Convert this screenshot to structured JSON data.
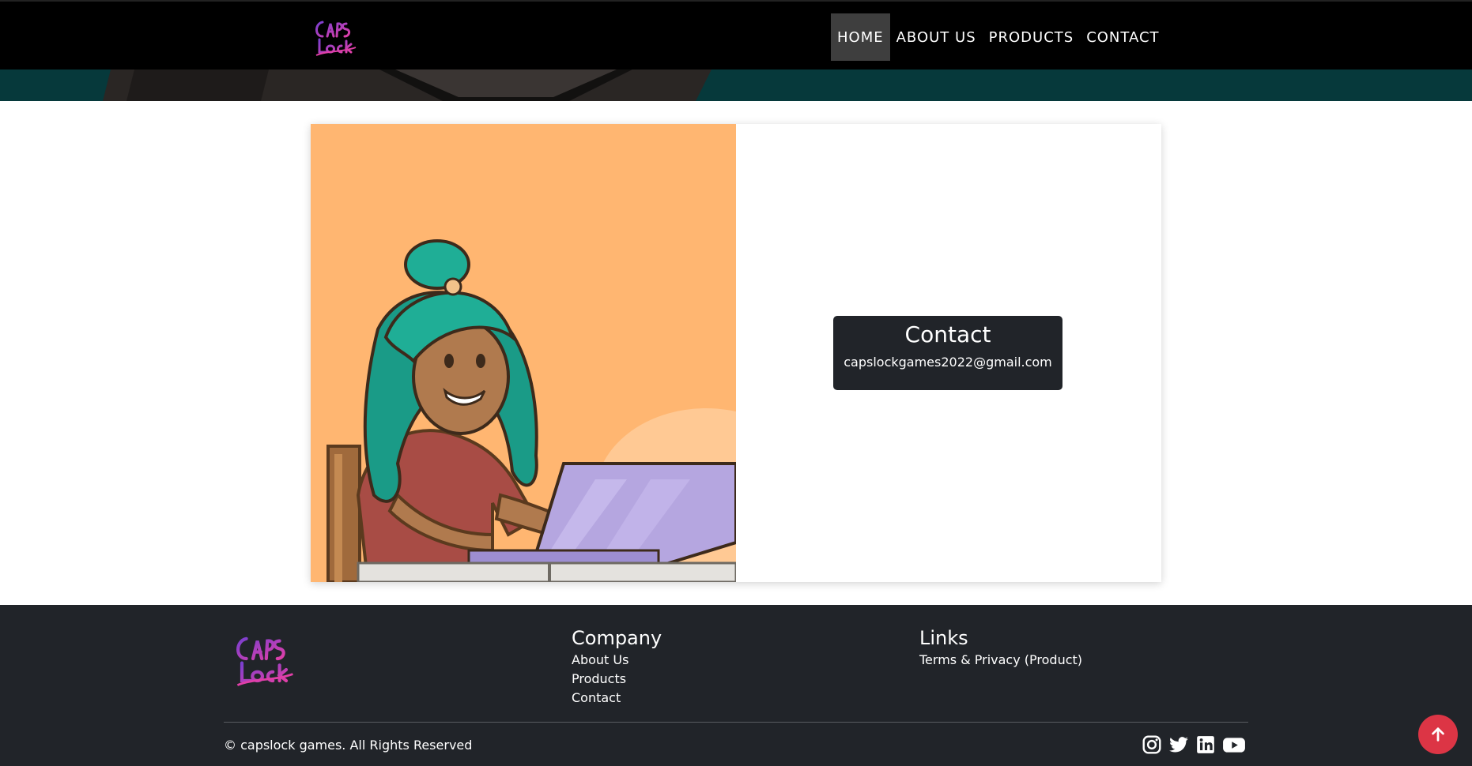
{
  "brand": {
    "logo_alt": "Caps Lock"
  },
  "nav": {
    "items": [
      {
        "label": "HOME",
        "active": true
      },
      {
        "label": "ABOUT US",
        "active": false
      },
      {
        "label": "PRODUCTS",
        "active": false
      },
      {
        "label": "CONTACT",
        "active": false
      }
    ]
  },
  "contact": {
    "title": "Contact",
    "email": "capslockgames2022@gmail.com"
  },
  "footer": {
    "company": {
      "heading": "Company",
      "links": [
        "About Us",
        "Products",
        "Contact"
      ]
    },
    "links": {
      "heading": "Links",
      "items": [
        "Terms & Privacy (Product)"
      ]
    },
    "copyright": "© capslock games. All Rights Reserved",
    "socials": [
      "instagram-icon",
      "twitter-icon",
      "linkedin-icon",
      "youtube-icon"
    ]
  },
  "colors": {
    "nav_bg": "#000000",
    "footer_bg": "#212429",
    "illustration_bg": "#ffb671",
    "accent_red": "#dc3545",
    "logo_pink": "#c03fbf"
  }
}
